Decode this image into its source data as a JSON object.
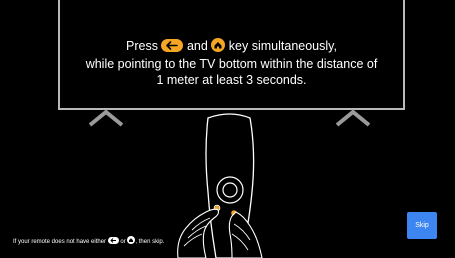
{
  "instruction": {
    "line1_before": "Press",
    "line1_and": "and",
    "line1_after": "key simultaneously,",
    "line2": "while pointing to the TV bottom within the distance of",
    "line3": "1 meter at least 3 seconds.",
    "back_key_icon": "back-arrow-icon",
    "home_key_icon": "home-icon",
    "key_color": "#f5a623"
  },
  "footnote": {
    "before": "If your remote does not have either",
    "middle": "or",
    "after": ", then skip."
  },
  "skip_button": {
    "label": "Skip",
    "color": "#3d86f2"
  },
  "remote": {
    "highlight_color": "#f5a623"
  }
}
